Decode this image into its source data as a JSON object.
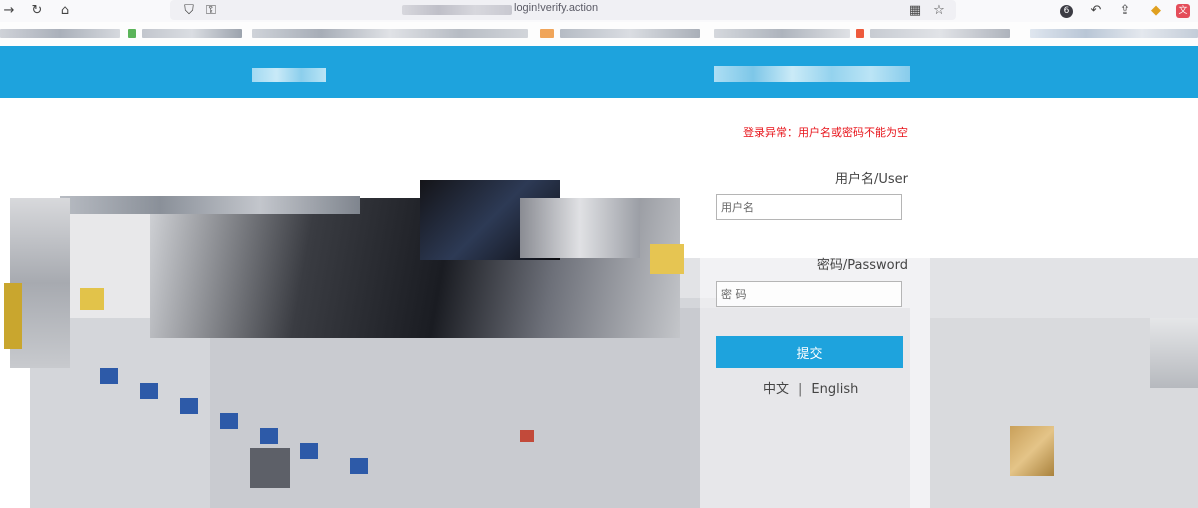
{
  "browser": {
    "url_visible": "login!verify.action",
    "icons": [
      "back-arrow-icon",
      "reload-icon",
      "home-icon",
      "shield-icon",
      "lock-icon",
      "qr-code-icon",
      "star-icon",
      "account-badge-icon",
      "undo-icon",
      "share-icon",
      "extension-icon",
      "translate-icon"
    ],
    "badge_count": "6"
  },
  "colors": {
    "accent": "#1ea3dd",
    "error": "#e8141b"
  },
  "login": {
    "error_message": "登录异常：用户名或密码不能为空",
    "username_label": "用户名/User",
    "username_placeholder": "用户名",
    "password_label": "密码/Password",
    "password_placeholder": "密 码",
    "submit_label": "提交",
    "lang_chinese": "中文",
    "lang_separator": "|",
    "lang_english": "English"
  }
}
